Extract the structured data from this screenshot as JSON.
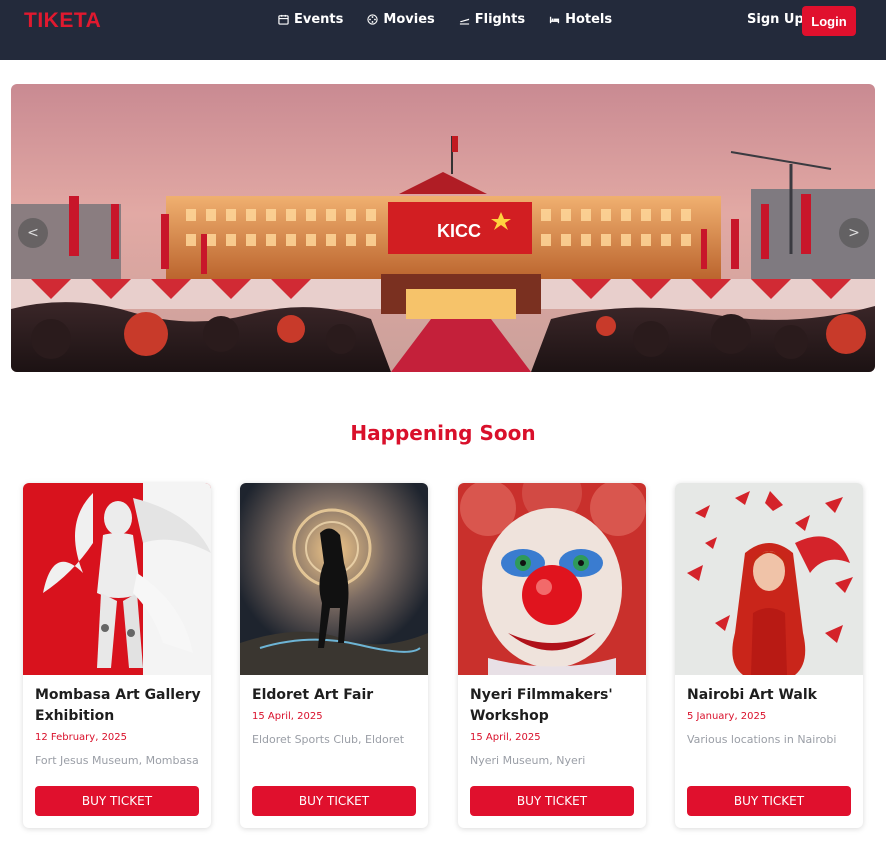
{
  "nav": {
    "brand": "TIKETA",
    "links": [
      {
        "label": "Events",
        "icon": "calendar-icon"
      },
      {
        "label": "Movies",
        "icon": "film-reel-icon"
      },
      {
        "label": "Flights",
        "icon": "plane-icon"
      },
      {
        "label": "Hotels",
        "icon": "bed-icon"
      }
    ],
    "signup": "Sign Up",
    "login": "Login"
  },
  "hero": {
    "banner_text": "KICC",
    "prev_label": "<",
    "next_label": ">"
  },
  "section": {
    "title": "Happening Soon"
  },
  "events": [
    {
      "title": "Mombasa Art Gallery Exhibition",
      "date": "12 February, 2025",
      "location": "Fort Jesus Museum, Mombasa",
      "cta": "BUY TICKET"
    },
    {
      "title": "Eldoret Art Fair",
      "date": "15 April, 2025",
      "location": "Eldoret Sports Club, Eldoret",
      "cta": "BUY TICKET"
    },
    {
      "title": "Nyeri Filmmakers' Workshop",
      "date": "15 April, 2025",
      "location": "Nyeri Museum, Nyeri",
      "cta": "BUY TICKET"
    },
    {
      "title": "Nairobi Art Walk",
      "date": "5 January, 2025",
      "location": "Various locations in Nairobi",
      "cta": "BUY TICKET"
    }
  ],
  "colors": {
    "nav_bg": "#232a3b",
    "accent": "#e0102d",
    "title_red": "#d9102b"
  }
}
